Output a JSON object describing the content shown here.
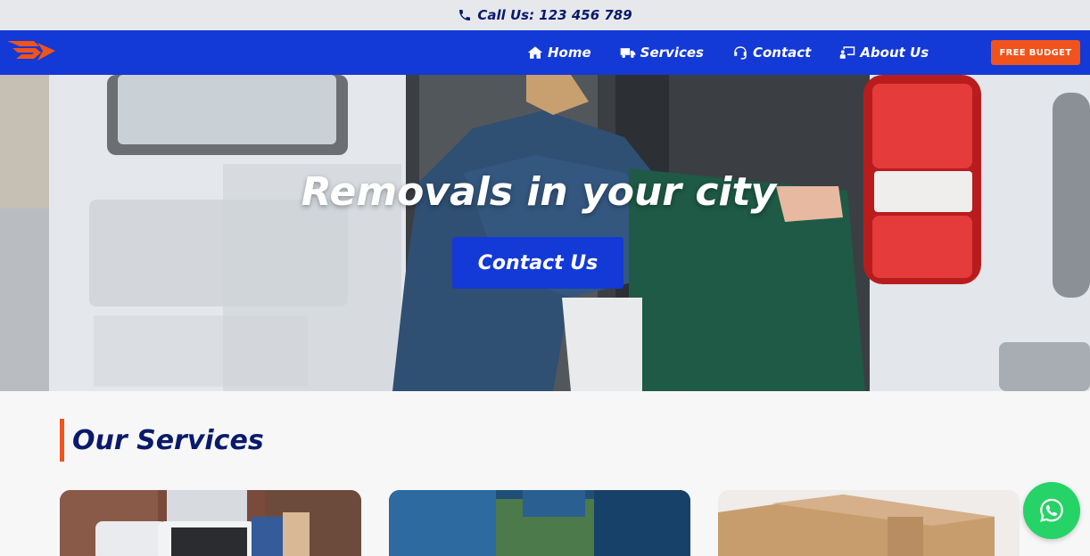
{
  "topbar": {
    "call_label": "Call Us: 123 456 789",
    "icon": "phone-icon"
  },
  "nav": {
    "items": [
      {
        "label": "Home",
        "icon": "home-icon"
      },
      {
        "label": "Services",
        "icon": "truck-icon"
      },
      {
        "label": "Contact",
        "icon": "headset-icon"
      },
      {
        "label": "About Us",
        "icon": "presentation-icon"
      }
    ],
    "budget_label": "FREE BUDGET"
  },
  "hero": {
    "title": "Removals in your city",
    "button_label": "Contact Us"
  },
  "services": {
    "title": "Our Services"
  },
  "colors": {
    "brand_blue": "#1339d6",
    "accent_orange": "#f0531b",
    "navy": "#0a1a6b",
    "whatsapp_green": "#25d366"
  }
}
